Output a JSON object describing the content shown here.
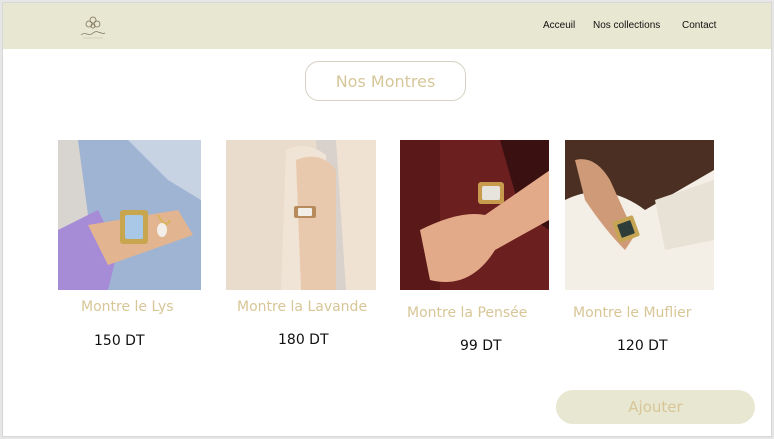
{
  "header": {
    "logo_text": "Flor Étoile",
    "nav": [
      {
        "label": "Acceuil"
      },
      {
        "label": "Nos collections"
      },
      {
        "label": "Contact"
      }
    ]
  },
  "main": {
    "title": "Nos Montres",
    "products": [
      {
        "name": "Montre le Lys",
        "price": "150 DT",
        "image": "watch-on-wrist-lavender-sleeve"
      },
      {
        "name": "Montre la Lavande",
        "price": "180 DT",
        "image": "watch-on-wrist-beige-top"
      },
      {
        "name": "Montre la Pensée",
        "price": "99 DT",
        "image": "watch-on-wrist-burgundy-dress"
      },
      {
        "name": "Montre le Muflier",
        "price": "120 DT",
        "image": "watch-on-wrist-white-top"
      }
    ],
    "add_button_label": "Ajouter"
  },
  "colors": {
    "header_bg": "#e8e7d2",
    "accent_gold": "#d8c697",
    "button_bg": "#e8e7d2"
  }
}
